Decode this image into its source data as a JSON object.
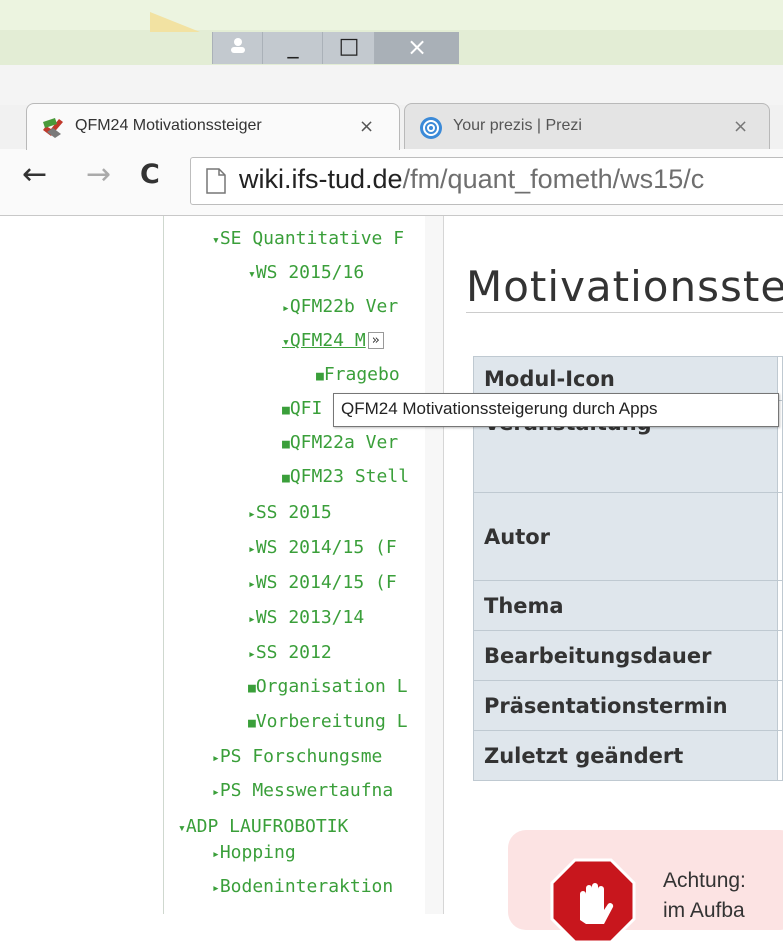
{
  "browser": {
    "tabs": [
      {
        "label": "QFM24 Motivationssteiger",
        "active": true
      },
      {
        "label": "Your prezis | Prezi",
        "active": false
      }
    ],
    "tab_close_glyph": "×",
    "url_host": "wiki.ifs-tud.de",
    "url_path": "/fm/quant_fometh/ws15/c",
    "back_glyph": "←",
    "forward_glyph": "→",
    "reload_glyph": "C"
  },
  "window_controls": {
    "minimize_glyph": "_",
    "maximize_glyph": "□",
    "close_glyph": "×"
  },
  "sidebar": {
    "items": [
      {
        "marker": "▾",
        "label": "SE Quantitative F"
      },
      {
        "marker": "▾",
        "label": "WS 2015/16"
      },
      {
        "marker": "▸",
        "label": "QFM22b Ver"
      },
      {
        "marker": "▾",
        "label": "QFM24 M"
      },
      {
        "marker": "■",
        "label": "Fragebo"
      },
      {
        "marker": "■",
        "label": "QFI"
      },
      {
        "marker": "■",
        "label": "QFM22a Ver"
      },
      {
        "marker": "■",
        "label": "QFM23 Stell"
      },
      {
        "marker": "▸",
        "label": "SS 2015"
      },
      {
        "marker": "▸",
        "label": "WS 2014/15 (F"
      },
      {
        "marker": "▸",
        "label": "WS 2014/15 (F"
      },
      {
        "marker": "▸",
        "label": "WS 2013/14"
      },
      {
        "marker": "▸",
        "label": "SS 2012"
      },
      {
        "marker": "■",
        "label": "Organisation L"
      },
      {
        "marker": "■",
        "label": "Vorbereitung L"
      },
      {
        "marker": "▸",
        "label": "PS Forschungsme"
      },
      {
        "marker": "▸",
        "label": "PS Messwertaufna"
      },
      {
        "marker": "▾",
        "label": "ADP LAUFROBOTIK"
      },
      {
        "marker": "▸",
        "label": "Hopping"
      },
      {
        "marker": "▸",
        "label": "Bodeninteraktion"
      }
    ],
    "expander_glyph": "»"
  },
  "tooltip": "QFM24 Motivationssteigerung durch Apps",
  "content": {
    "title": "Motivationsste",
    "table_rows": [
      "Modul-Icon",
      "Veranstaltung",
      "Autor",
      "Thema",
      "Bearbeitungsdauer",
      "Präsentationstermin",
      "Zuletzt geändert"
    ],
    "warning_line1": "Achtung:",
    "warning_line2": "im Aufba"
  },
  "colors": {
    "link_green": "#3a9f3a",
    "table_header": "#dfe6ec",
    "warning_bg": "#fce3e3",
    "stop_red": "#c8161d"
  }
}
